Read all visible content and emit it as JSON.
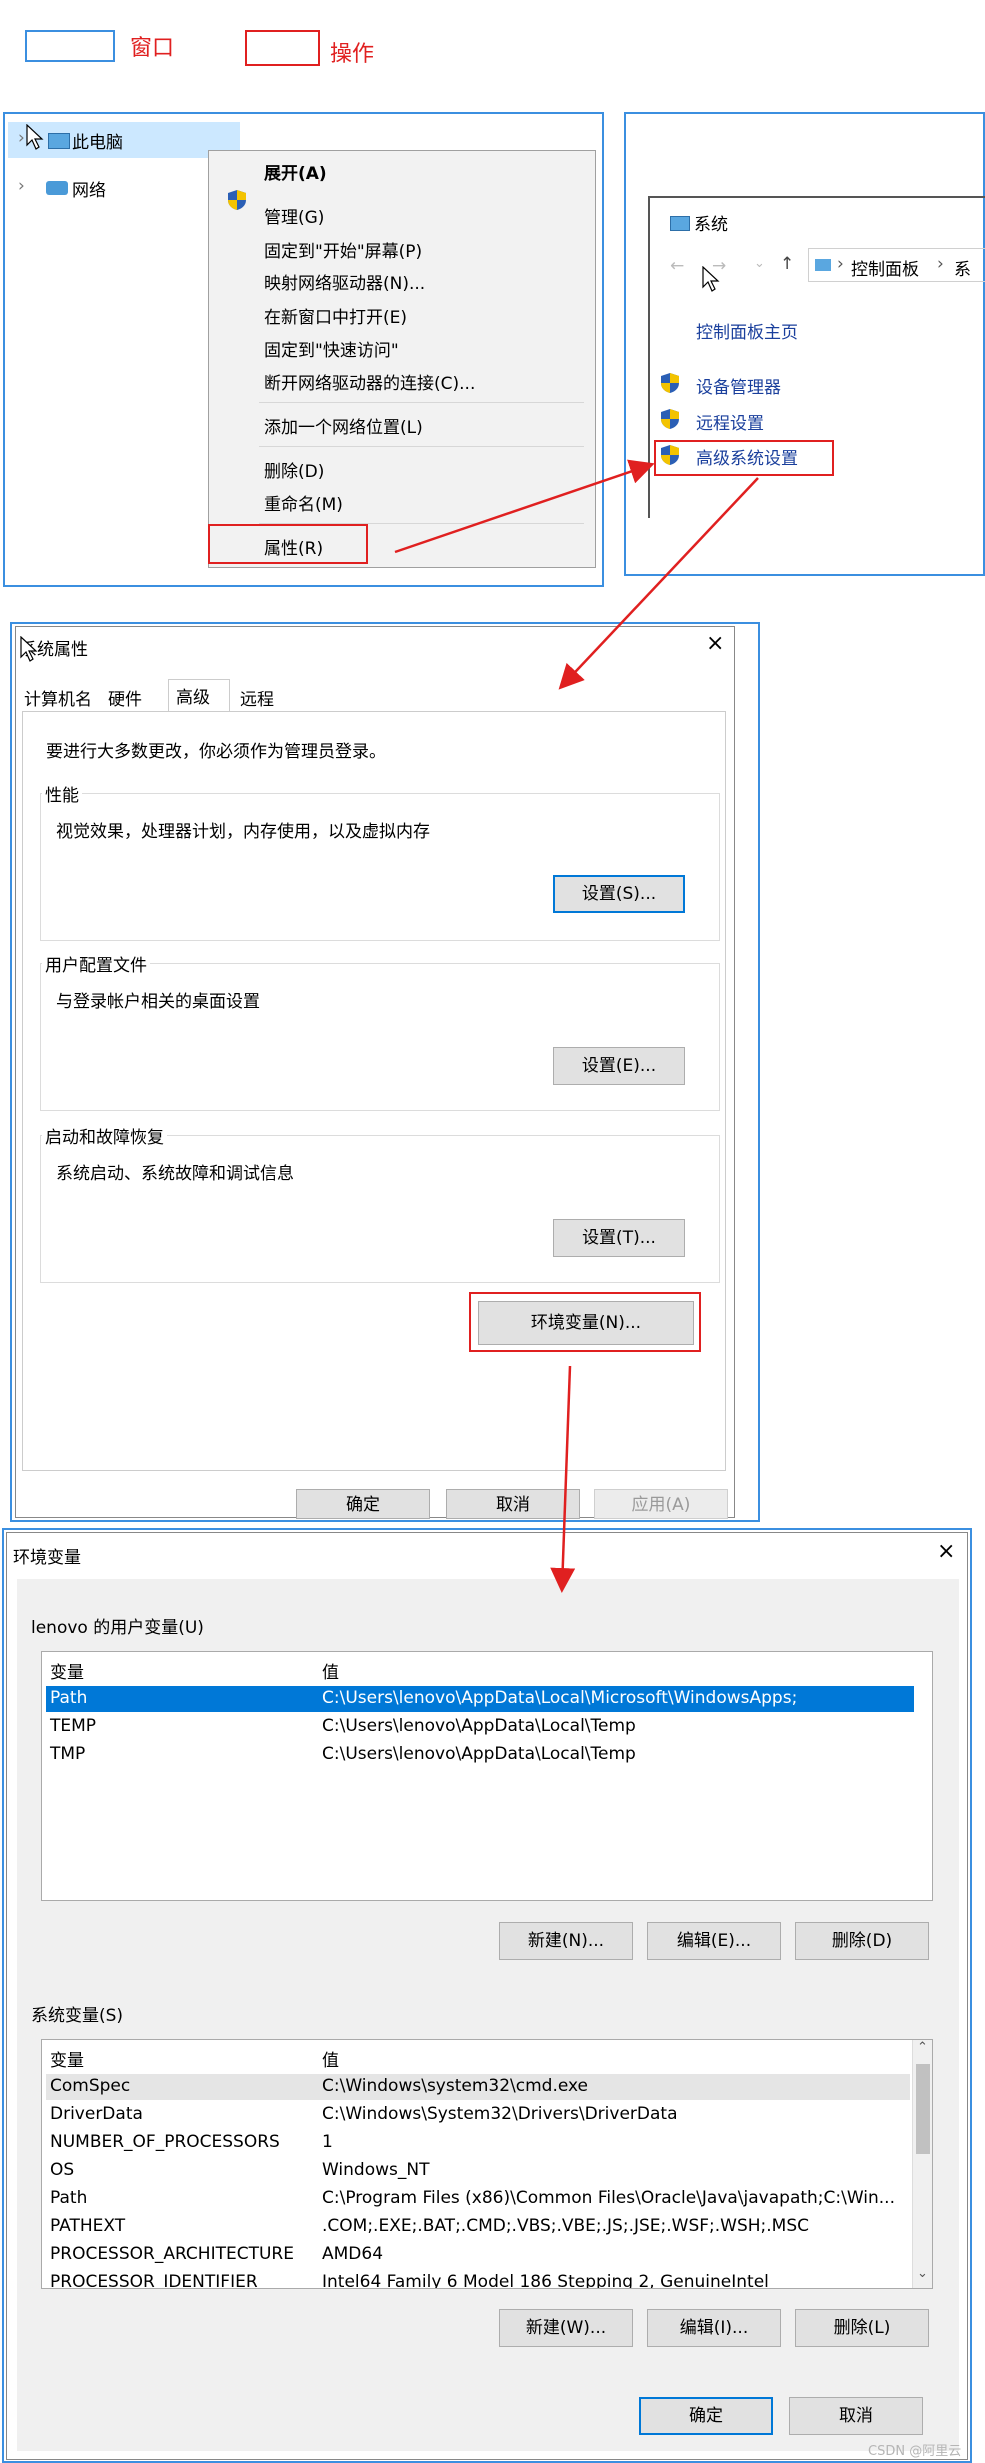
{
  "legend": {
    "window_label": "窗口",
    "action_label": "操作"
  },
  "explorer": {
    "items": [
      "此电脑",
      "网络"
    ],
    "context_menu": {
      "items": [
        "展开(A)",
        "管理(G)",
        "固定到\"开始\"屏幕(P)",
        "映射网络驱动器(N)...",
        "在新窗口中打开(E)",
        "固定到\"快速访问\"",
        "断开网络驱动器的连接(C)...",
        "添加一个网络位置(L)",
        "删除(D)",
        "重命名(M)",
        "属性(R)"
      ]
    }
  },
  "system_panel": {
    "title": "系统",
    "breadcrumb": [
      "控制面板",
      "系"
    ],
    "home_link": "控制面板主页",
    "links": [
      "设备管理器",
      "远程设置",
      "高级系统设置"
    ]
  },
  "sysprops": {
    "title": "系统属性",
    "tabs": [
      "计算机名",
      "硬件",
      "高级",
      "远程"
    ],
    "admin_note": "要进行大多数更改，你必须作为管理员登录。",
    "groups": [
      {
        "title": "性能",
        "desc": "视觉效果，处理器计划，内存使用，以及虚拟内存",
        "button": "设置(S)..."
      },
      {
        "title": "用户配置文件",
        "desc": "与登录帐户相关的桌面设置",
        "button": "设置(E)..."
      },
      {
        "title": "启动和故障恢复",
        "desc": "系统启动、系统故障和调试信息",
        "button": "设置(T)..."
      }
    ],
    "env_button": "环境变量(N)...",
    "ok": "确定",
    "cancel": "取消",
    "apply": "应用(A)"
  },
  "envvars": {
    "title": "环境变量",
    "user_section": "lenovo 的用户变量(U)",
    "col_var": "变量",
    "col_val": "值",
    "user_rows": [
      {
        "name": "Path",
        "value": "C:\\Users\\lenovo\\AppData\\Local\\Microsoft\\WindowsApps;"
      },
      {
        "name": "TEMP",
        "value": "C:\\Users\\lenovo\\AppData\\Local\\Temp"
      },
      {
        "name": "TMP",
        "value": "C:\\Users\\lenovo\\AppData\\Local\\Temp"
      }
    ],
    "user_buttons": [
      "新建(N)...",
      "编辑(E)...",
      "删除(D)"
    ],
    "system_section": "系统变量(S)",
    "system_rows": [
      {
        "name": "ComSpec",
        "value": "C:\\Windows\\system32\\cmd.exe"
      },
      {
        "name": "DriverData",
        "value": "C:\\Windows\\System32\\Drivers\\DriverData"
      },
      {
        "name": "NUMBER_OF_PROCESSORS",
        "value": "1"
      },
      {
        "name": "OS",
        "value": "Windows_NT"
      },
      {
        "name": "Path",
        "value": "C:\\Program Files (x86)\\Common Files\\Oracle\\Java\\javapath;C:\\Win..."
      },
      {
        "name": "PATHEXT",
        "value": ".COM;.EXE;.BAT;.CMD;.VBS;.VBE;.JS;.JSE;.WSF;.WSH;.MSC"
      },
      {
        "name": "PROCESSOR_ARCHITECTURE",
        "value": "AMD64"
      },
      {
        "name": "PROCESSOR_IDENTIFIER",
        "value": "Intel64 Family 6 Model 186 Stepping 2, GenuineIntel"
      }
    ],
    "system_buttons": [
      "新建(W)...",
      "编辑(I)...",
      "删除(L)"
    ],
    "ok": "确定",
    "cancel": "取消"
  },
  "watermark": "CSDN @阿里云",
  "colors": {
    "accent": "#0078d7",
    "annotation_red": "#e02020",
    "annotation_blue": "#3b8fe0"
  }
}
